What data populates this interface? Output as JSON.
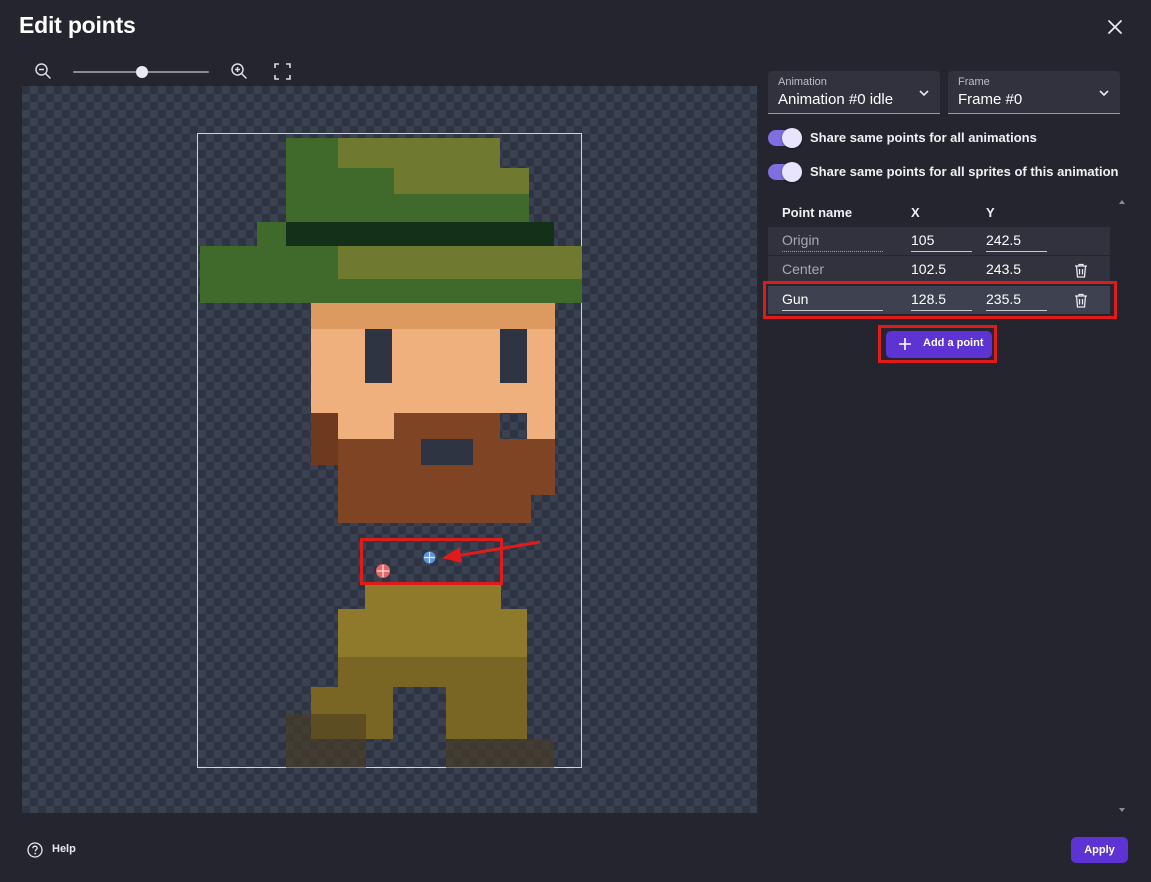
{
  "dialog": {
    "title": "Edit points"
  },
  "toolbar": {
    "zoom_level": 0.5
  },
  "animation_select": {
    "label": "Animation",
    "value": "Animation #0 idle"
  },
  "frame_select": {
    "label": "Frame",
    "value": "Frame #0"
  },
  "toggles": [
    {
      "label": "Share same points for all animations",
      "on": true
    },
    {
      "label": "Share same points for all sprites of this animation",
      "on": true
    }
  ],
  "table": {
    "headers": {
      "name": "Point name",
      "x": "X",
      "y": "Y"
    },
    "rows": [
      {
        "name": "Origin",
        "x": "105",
        "y": "242.5",
        "deletable": false,
        "selected": false
      },
      {
        "name": "Center",
        "x": "102.5",
        "y": "243.5",
        "deletable": true,
        "selected": false
      },
      {
        "name": "Gun",
        "x": "128.5",
        "y": "235.5",
        "deletable": true,
        "selected": true
      }
    ]
  },
  "add_point_button": {
    "label": "Add a point"
  },
  "footer": {
    "help_label": "Help",
    "apply_label": "Apply"
  },
  "colors": {
    "accent": "#5e33d4",
    "toggle": "#7e6fe0",
    "annotation": "#e01b1b",
    "panel": "#25252f"
  }
}
